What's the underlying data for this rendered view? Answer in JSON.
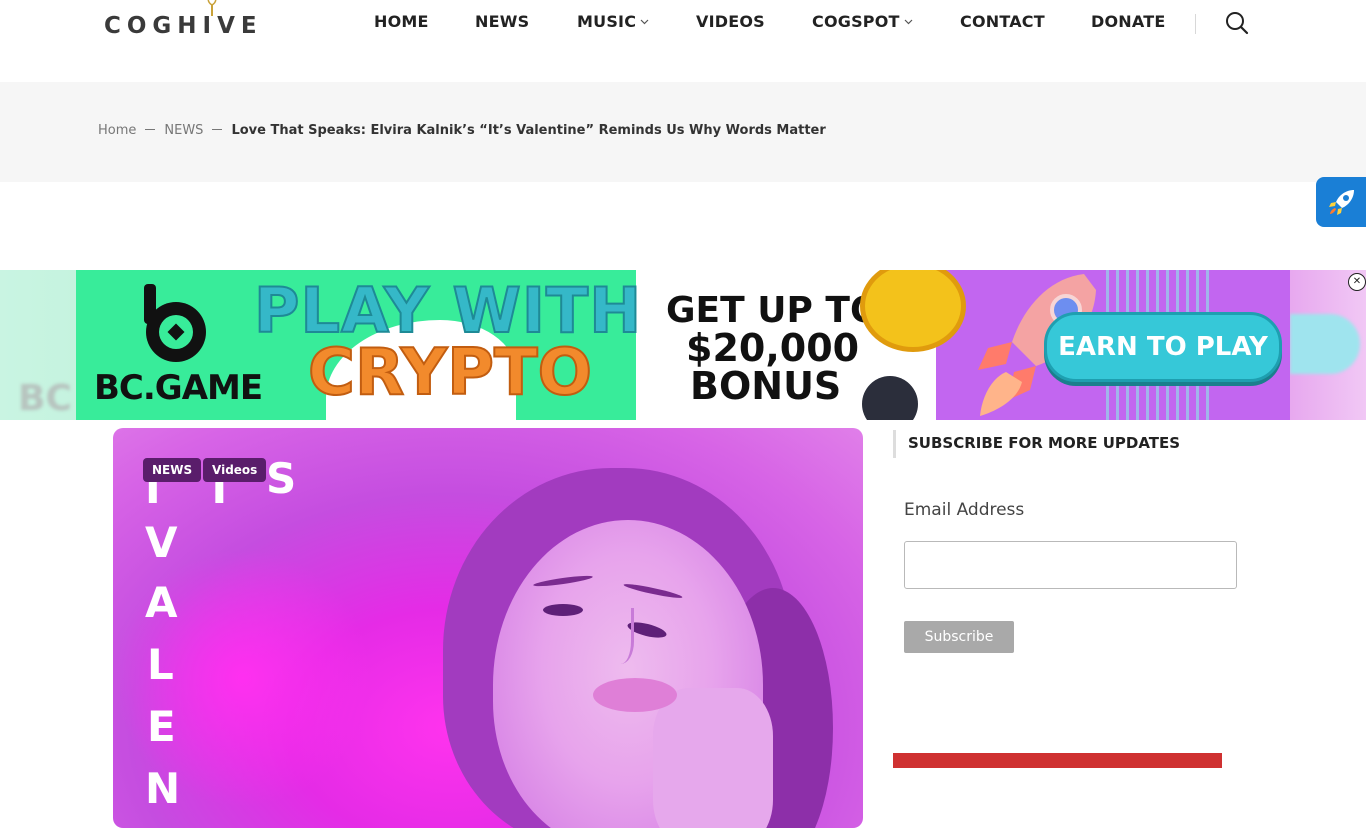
{
  "logo": {
    "text": "COGHIVE"
  },
  "nav": {
    "home": "HOME",
    "news": "NEWS",
    "music": "MUSIC",
    "videos": "VIDEOS",
    "cogspot": "COGSPOT",
    "contact": "CONTACT",
    "donate": "DONATE"
  },
  "breadcrumb": {
    "home": "Home",
    "section": "NEWS",
    "current": "Love That Speaks: Elvira Kalnik’s “It’s Valentine” Reminds Us Why Words Matter"
  },
  "ad": {
    "brand": "BC.GAME",
    "headline_1": "PLAY WITH",
    "headline_2": "CRYPTO",
    "offer_1": "GET UP TO",
    "offer_2": "$20,000",
    "offer_3": "BONUS",
    "cta": "EARN TO PLAY"
  },
  "featured": {
    "tags": [
      "NEWS",
      "Videos"
    ],
    "cover_letters": [
      "I",
      "T",
      "S",
      "V",
      "A",
      "L",
      "E",
      "N"
    ]
  },
  "sidebar": {
    "title": "SUBSCRIBE FOR MORE UPDATES",
    "email_label": "Email Address",
    "email_value": "",
    "subscribe_label": "Subscribe"
  },
  "colors": {
    "accent_purple": "#5a1d6b",
    "ad_green": "#38ec9a",
    "float_button_blue": "#1a7fd6",
    "sidebar_red": "#cf3131"
  },
  "icons": [
    "search-icon",
    "chevron-down-icon",
    "rocket-icon",
    "close-icon"
  ]
}
